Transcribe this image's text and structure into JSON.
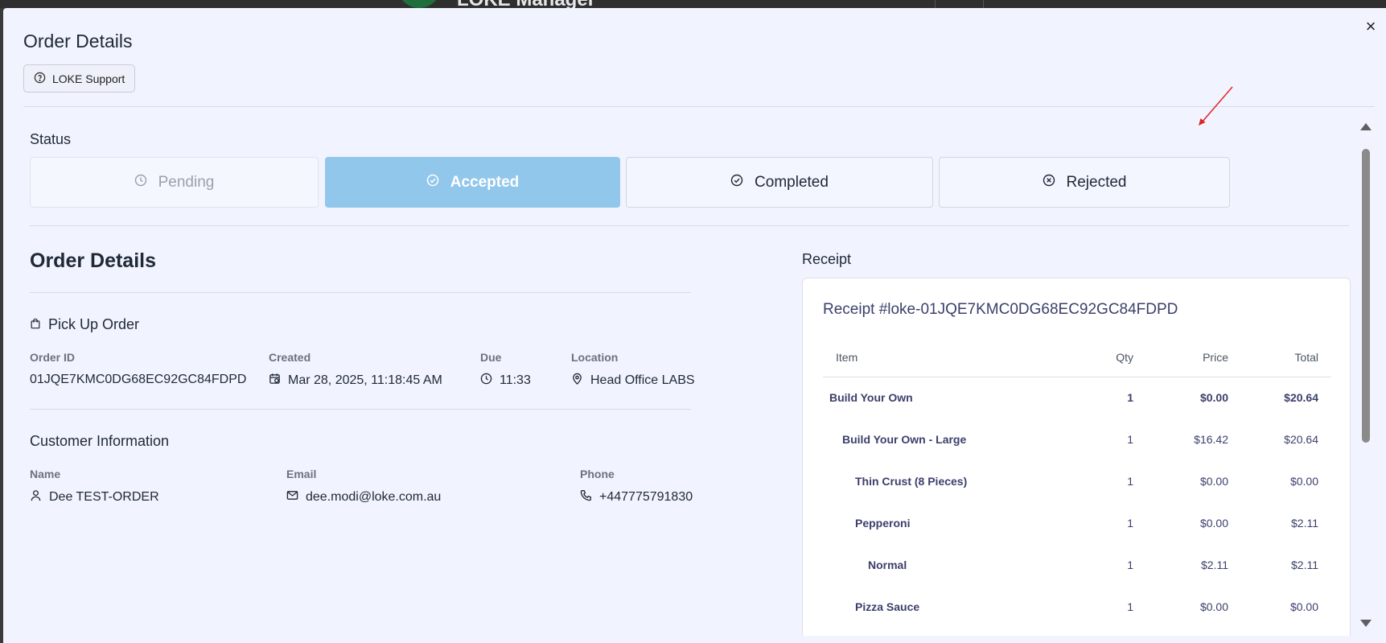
{
  "background": {
    "app_title": "LOKE Manager"
  },
  "modal": {
    "title": "Order Details",
    "close_label": "×",
    "support_label": "LOKE Support"
  },
  "status": {
    "label": "Status",
    "options": [
      {
        "label": "Pending",
        "state": "disabled",
        "icon": "clock-icon"
      },
      {
        "label": "Accepted",
        "state": "active",
        "icon": "check-circle-icon"
      },
      {
        "label": "Completed",
        "state": "default",
        "icon": "check-circle-icon"
      },
      {
        "label": "Rejected",
        "state": "default",
        "icon": "x-circle-icon"
      }
    ]
  },
  "order": {
    "section_title": "Order Details",
    "type_label": "Pick Up Order",
    "fields": {
      "order_id_label": "Order ID",
      "order_id": "01JQE7KMC0DG68EC92GC84FDPD",
      "created_label": "Created",
      "created": "Mar 28, 2025, 11:18:45 AM",
      "due_label": "Due",
      "due": "11:33",
      "location_label": "Location",
      "location": "Head Office LABS"
    }
  },
  "customer": {
    "section_title": "Customer Information",
    "name_label": "Name",
    "name": "Dee TEST-ORDER",
    "email_label": "Email",
    "email": "dee.modi@loke.com.au",
    "phone_label": "Phone",
    "phone": "+447775791830"
  },
  "receipt": {
    "label": "Receipt",
    "title": "Receipt #loke-01JQE7KMC0DG68EC92GC84FDPD",
    "columns": [
      "Item",
      "Qty",
      "Price",
      "Total"
    ],
    "rows": [
      {
        "item": "Build Your Own",
        "qty": "1",
        "price": "$0.00",
        "total": "$20.64",
        "level": 0
      },
      {
        "item": "Build Your Own - Large",
        "qty": "1",
        "price": "$16.42",
        "total": "$20.64",
        "level": 1
      },
      {
        "item": "Thin Crust (8 Pieces)",
        "qty": "1",
        "price": "$0.00",
        "total": "$0.00",
        "level": 2
      },
      {
        "item": "Pepperoni",
        "qty": "1",
        "price": "$0.00",
        "total": "$2.11",
        "level": 2
      },
      {
        "item": "Normal",
        "qty": "1",
        "price": "$2.11",
        "total": "$2.11",
        "level": 3
      },
      {
        "item": "Pizza Sauce",
        "qty": "1",
        "price": "$0.00",
        "total": "$0.00",
        "level": 2
      }
    ]
  },
  "colors": {
    "accepted_bg": "#92c7ec",
    "modal_bg": "#f1f3fe",
    "annotation_arrow": "#e02424"
  }
}
